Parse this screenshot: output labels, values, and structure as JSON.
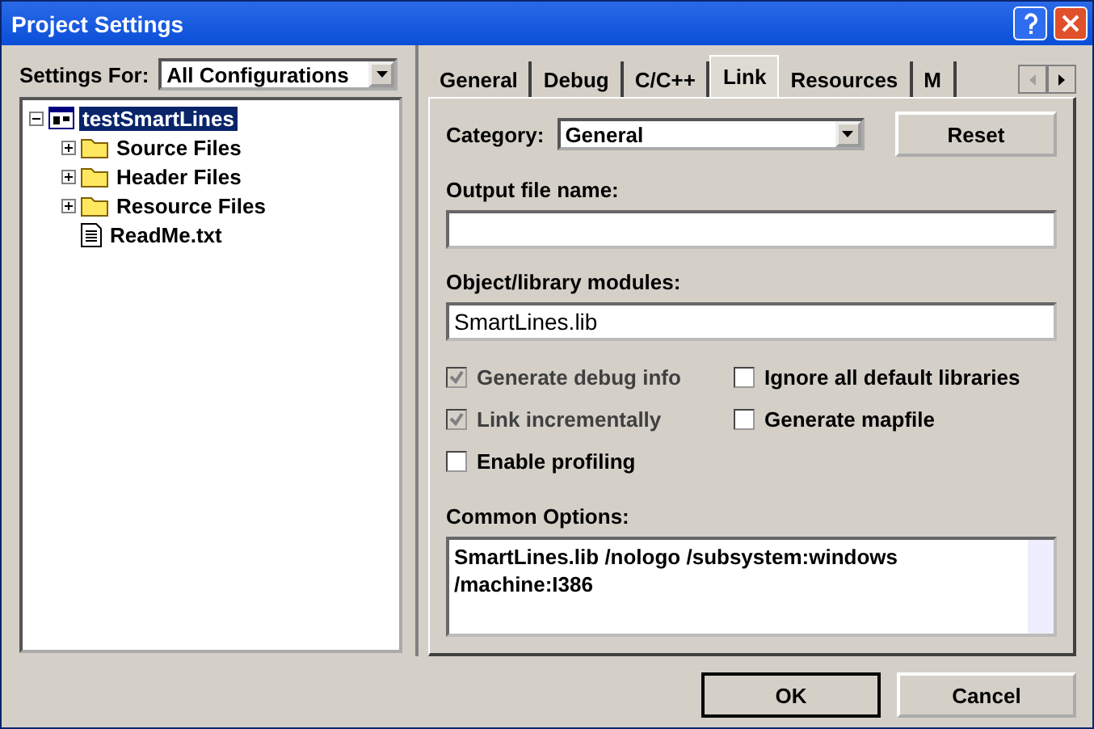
{
  "window": {
    "title": "Project Settings"
  },
  "settings_for": {
    "label": "Settings For:",
    "value": "All Configurations"
  },
  "tree": [
    {
      "label": "testSmartLines",
      "kind": "project",
      "expanded": true,
      "selected": true,
      "children": [
        {
          "label": "Source Files",
          "kind": "folder",
          "expanded": false,
          "selected": false
        },
        {
          "label": "Header Files",
          "kind": "folder",
          "expanded": false,
          "selected": false
        },
        {
          "label": "Resource Files",
          "kind": "folder",
          "expanded": false,
          "selected": false
        },
        {
          "label": "ReadMe.txt",
          "kind": "file",
          "selected": false
        }
      ]
    }
  ],
  "tabs": [
    {
      "label": "General",
      "selected": false
    },
    {
      "label": "Debug",
      "selected": false
    },
    {
      "label": "C/C++",
      "selected": false
    },
    {
      "label": "Link",
      "selected": true
    },
    {
      "label": "Resources",
      "selected": false
    },
    {
      "label": "M",
      "selected": false
    }
  ],
  "category": {
    "label": "Category:",
    "value": "General"
  },
  "reset_button": "Reset",
  "output_file": {
    "label": "Output file name:"
  },
  "modules": {
    "label": "Object/library modules:",
    "value": "SmartLines.lib"
  },
  "options": [
    {
      "label": "Generate debug info",
      "checked": true,
      "disabled": true
    },
    {
      "label": "Ignore all default libraries",
      "checked": false,
      "disabled": false
    },
    {
      "label": "Link incrementally",
      "checked": true,
      "disabled": true
    },
    {
      "label": "Generate mapfile",
      "checked": false,
      "disabled": false
    },
    {
      "label": "Enable profiling",
      "checked": false,
      "disabled": false
    }
  ],
  "common_options": {
    "label": "Common Options:",
    "value": "SmartLines.lib /nologo /subsystem:windows\n/machine:I386"
  },
  "buttons": [
    "OK",
    "Cancel"
  ]
}
